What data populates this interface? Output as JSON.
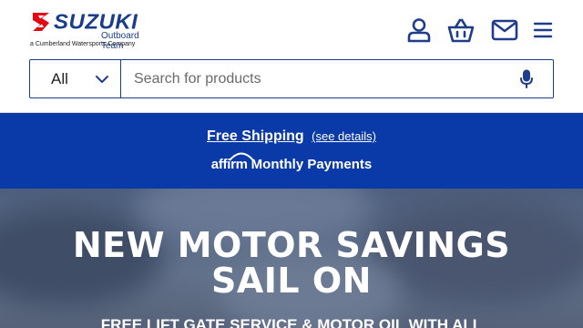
{
  "logo": {
    "brand": "SUZUKI",
    "subtitle": "Outboard Team",
    "tagline": "a Cumberland Watersports Company",
    "brand_color": "#1a3c8c",
    "mark_color": "#e30613"
  },
  "header_icons": [
    "user-icon",
    "basket-icon",
    "mail-icon",
    "menu-icon"
  ],
  "search": {
    "category_selected": "All",
    "placeholder": "Search for products",
    "value": ""
  },
  "promo": {
    "free_shipping": "Free Shipping",
    "see_details": "(see details)",
    "affirm_logo": "affirm",
    "monthly_payments": "Monthly Payments",
    "background": "#0a3aa7"
  },
  "hero": {
    "title_line1": "NEW MOTOR SAVINGS",
    "title_line2": "SAIL ON",
    "subtitle": "FREE LIFT GATE SERVICE & MOTOR OIL WITH ALL"
  },
  "colors": {
    "accent": "#1f3d8a",
    "icon": "#1f3d8a"
  }
}
